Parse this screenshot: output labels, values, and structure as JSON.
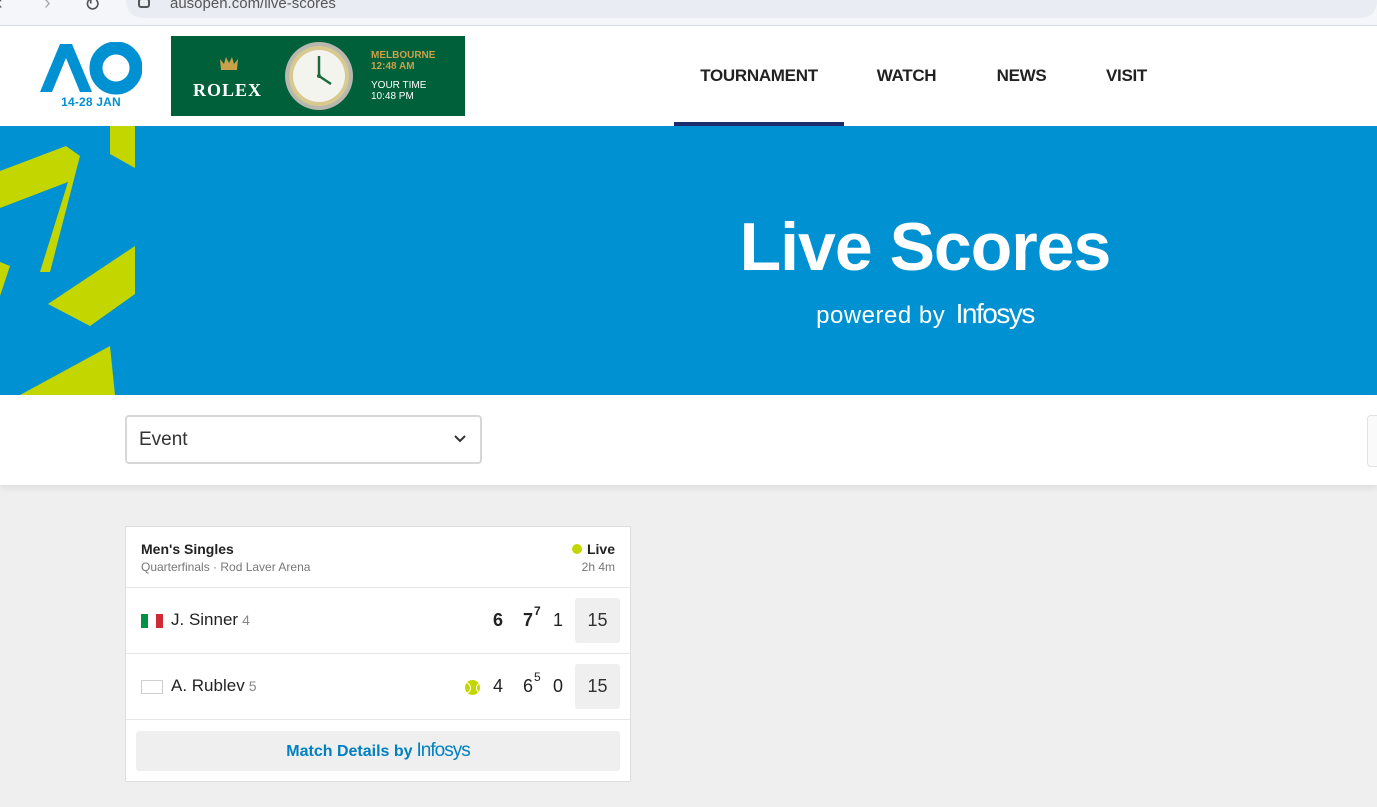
{
  "browser": {
    "url": "ausopen.com/live-scores",
    "back_glyph": "‹",
    "forward_glyph": "›",
    "reload_glyph": "↻"
  },
  "header": {
    "logo_dates": "14-28 JAN",
    "ad": {
      "brand": "ROLEX",
      "city_label": "MELBOURNE",
      "city_time": "12:48 AM",
      "your_label": "YOUR TIME",
      "your_time": "10:48 PM"
    },
    "nav": [
      {
        "label": "TOURNAMENT",
        "active": true
      },
      {
        "label": "WATCH",
        "active": false
      },
      {
        "label": "NEWS",
        "active": false
      },
      {
        "label": "VISIT",
        "active": false
      }
    ]
  },
  "hero": {
    "title": "Live Scores",
    "powered_text": "powered by",
    "powered_brand": "Infosys"
  },
  "filter": {
    "event_label": "Event"
  },
  "match": {
    "event": "Men's Singles",
    "round_court": "Quarterfinals · Rod Laver Arena",
    "status": "Live",
    "duration": "2h 4m",
    "players": [
      {
        "name": "J. Sinner",
        "seed": "4",
        "flag": "italy",
        "serving": false,
        "sets": [
          {
            "score": "6",
            "tiebreak": "",
            "won": true
          },
          {
            "score": "7",
            "tiebreak": "7",
            "won": true
          },
          {
            "score": "1",
            "tiebreak": "",
            "won": false
          }
        ],
        "game": "15"
      },
      {
        "name": "A. Rublev",
        "seed": "5",
        "flag": "neutral",
        "serving": true,
        "sets": [
          {
            "score": "4",
            "tiebreak": "",
            "won": false
          },
          {
            "score": "6",
            "tiebreak": "5",
            "won": false
          },
          {
            "score": "0",
            "tiebreak": "",
            "won": false
          }
        ],
        "game": "15"
      }
    ],
    "details_text": "Match Details by",
    "details_brand": "Infosys"
  },
  "colors": {
    "brand_blue": "#0091d2",
    "accent_lime": "#c3d600",
    "nav_underline": "#1e2b6c",
    "rolex_green": "#006039"
  }
}
